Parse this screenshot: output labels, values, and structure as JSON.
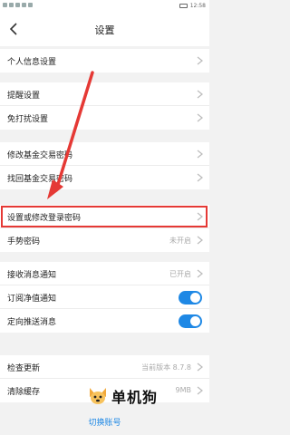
{
  "statusbar": {
    "time": "12:58"
  },
  "header": {
    "title": "设置"
  },
  "groups": {
    "g1": {
      "items": [
        {
          "label": "个人信息设置"
        }
      ]
    },
    "g2": {
      "items": [
        {
          "label": "提醒设置"
        },
        {
          "label": "免打扰设置"
        }
      ]
    },
    "g3": {
      "items": [
        {
          "label": "修改基金交易密码"
        },
        {
          "label": "找回基金交易密码"
        }
      ]
    },
    "g4": {
      "items": [
        {
          "label": "设置或修改登录密码"
        },
        {
          "label": "手势密码",
          "value": "未开启"
        }
      ]
    },
    "g5": {
      "items": [
        {
          "label": "接收消息通知",
          "value": "已开启"
        },
        {
          "label": "订阅净值通知",
          "toggle": true
        },
        {
          "label": "定向推送消息",
          "toggle": true
        }
      ]
    },
    "g6": {
      "items": [
        {
          "label": "检查更新",
          "value": "当前版本 8.7.8"
        },
        {
          "label": "清除缓存",
          "value": "9MB"
        }
      ]
    }
  },
  "footer": {
    "switch_account": "切换账号"
  },
  "watermark": {
    "text": "单机狗"
  },
  "colors": {
    "accent": "#1e88e5",
    "highlight": "#e53935"
  }
}
